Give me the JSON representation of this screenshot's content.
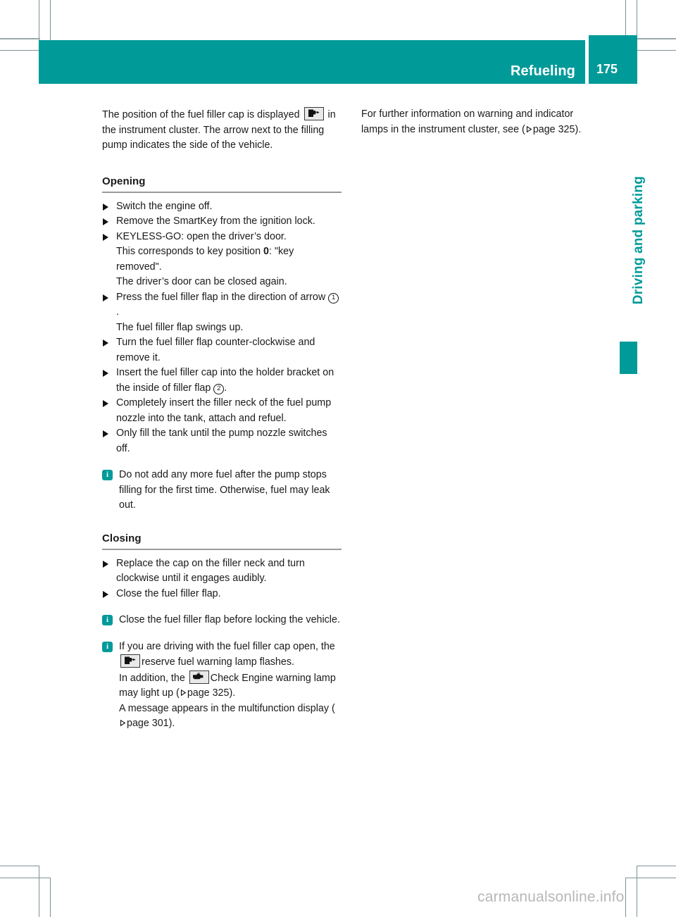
{
  "colors": {
    "teal": "#009a99",
    "cropmark": "#7d9296",
    "rule": "#9a9a9a",
    "watermark": "#b7b7b7"
  },
  "header": {
    "title": "Refueling",
    "page_number": "175"
  },
  "side_tab": {
    "label": "Driving and parking"
  },
  "left_column": {
    "intro": {
      "part1": "The position of the fuel filler cap is displayed",
      "icon": "fuel-pump-indicator-icon",
      "part2": "in the instrument cluster. The arrow next to the filling pump indicates the side of the vehicle."
    },
    "opening": {
      "heading": "Opening",
      "steps": [
        {
          "text": "Switch the engine off."
        },
        {
          "text": "Remove the SmartKey from the ignition lock."
        },
        {
          "text": "KEYLESS-GO: open the driver’s door.",
          "sub1_pre": "This corresponds to key position ",
          "sub1_bold": "0",
          "sub1_post": ": \"key removed\".",
          "sub2": "The driver’s door can be closed again."
        },
        {
          "text_pre": "Press the fuel filler flap in the direction of arrow ",
          "callout": "1",
          "text_post": ".",
          "sub1": "The fuel filler flap swings up."
        },
        {
          "text": "Turn the fuel filler flap counter-clockwise and remove it."
        },
        {
          "text_pre": "Insert the fuel filler cap into the holder bracket on the inside of filler flap ",
          "callout": "2",
          "text_post": "."
        },
        {
          "text": "Completely insert the filler neck of the fuel pump nozzle into the tank, attach and refuel."
        },
        {
          "text": "Only fill the tank until the pump nozzle switches off."
        }
      ],
      "note": "Do not add any more fuel after the pump stops filling for the first time. Otherwise, fuel may leak out."
    },
    "closing": {
      "heading": "Closing",
      "steps": [
        {
          "text": "Replace the cap on the filler neck and turn clockwise until it engages audibly."
        },
        {
          "text": "Close the fuel filler flap."
        }
      ],
      "note1": "Close the fuel filler flap before locking the vehicle.",
      "note2": {
        "line1_pre": "If you are driving with the fuel filler cap open, the ",
        "line1_icon": "fuel-pump-indicator-icon",
        "line1_post": "reserve fuel warning lamp flashes.",
        "line2_pre": "In addition, the ",
        "line2_icon": "check-engine-icon",
        "line2_mid": "Check Engine warning lamp may light up (",
        "line2_xref": "page 325",
        "line2_post": ").",
        "line3_pre": "A message appears in the multifunction display (",
        "line3_xref": "page 301",
        "line3_post": ")."
      }
    }
  },
  "right_column": {
    "paragraph_pre": "For further information on warning and indicator lamps in the instrument cluster, see (",
    "paragraph_xref": "page 325",
    "paragraph_post": ")."
  },
  "watermark": "carmanualsonline.info"
}
